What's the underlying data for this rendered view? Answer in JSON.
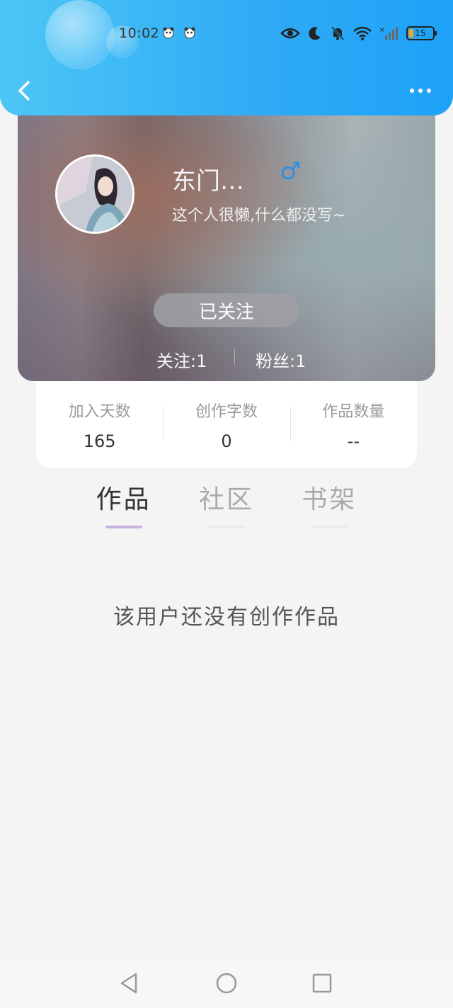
{
  "status_bar": {
    "time": "10:02",
    "battery": "15"
  },
  "header": {
    "back_icon": "chevron-left-icon",
    "more_icon": "more-dots-icon"
  },
  "profile": {
    "username": "东门…",
    "gender_symbol": "♂",
    "bio": "这个人很懒,什么都没写~",
    "follow_button": "已关注",
    "following": "关注:1",
    "fans": "粉丝:1"
  },
  "stats": [
    {
      "label": "加入天数",
      "value": "165"
    },
    {
      "label": "创作字数",
      "value": "0"
    },
    {
      "label": "作品数量",
      "value": "--"
    }
  ],
  "tabs": [
    {
      "label": "作品",
      "active": true
    },
    {
      "label": "社区",
      "active": false
    },
    {
      "label": "书架",
      "active": false
    }
  ],
  "empty_message": "该用户还没有创作作品",
  "colors": {
    "header_blue": "#2eaaf6",
    "gender_blue": "#2f8fe0",
    "tab_active_underline": "#c6b2e2"
  }
}
